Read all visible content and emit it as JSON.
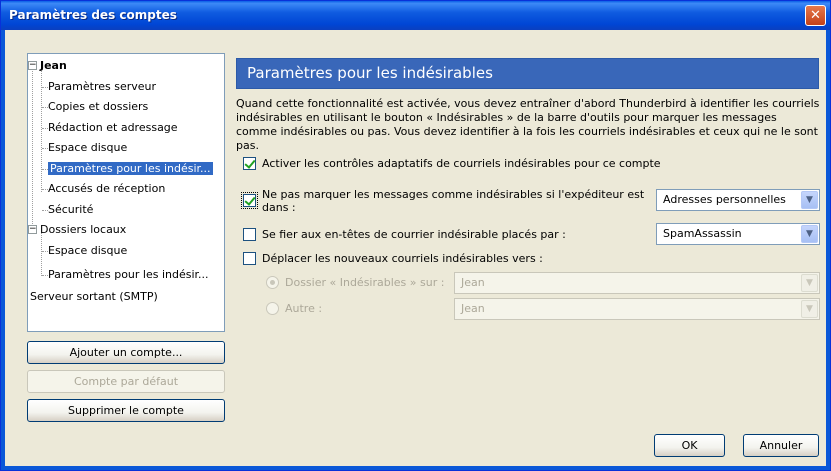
{
  "window": {
    "title": "Paramètres des comptes"
  },
  "tree": {
    "items": [
      {
        "label": "Jean",
        "level": 0,
        "bold": true
      },
      {
        "label": "Paramètres serveur",
        "level": 1
      },
      {
        "label": "Copies et dossiers",
        "level": 1
      },
      {
        "label": "Rédaction et adressage",
        "level": 1
      },
      {
        "label": "Espace disque",
        "level": 1
      },
      {
        "label": "Paramètres pour les indésir...",
        "level": 1,
        "selected": true
      },
      {
        "label": "Accusés de réception",
        "level": 1
      },
      {
        "label": "Sécurité",
        "level": 1
      },
      {
        "label": "Dossiers locaux",
        "level": 0
      },
      {
        "label": "Espace disque",
        "level": 1
      },
      {
        "label": "Paramètres pour les indésir...",
        "level": 1
      },
      {
        "label": "Serveur sortant (SMTP)",
        "level": 0
      }
    ]
  },
  "left_buttons": {
    "add": "Ajouter un compte...",
    "default": "Compte par défaut",
    "delete": "Supprimer le compte"
  },
  "panel": {
    "title": "Paramètres pour les indésirables",
    "description": "Quand cette fonctionnalité est activée, vous devez entraîner d'abord Thunderbird à identifier les courriels indésirables en utilisant le bouton « Indésirables » de la barre d'outils pour marquer les messages comme indésirables ou pas. Vous devez identifier à la fois les courriels indésirables et ceux qui ne le sont pas."
  },
  "options": {
    "adaptive": {
      "label": "Activer les contrôles adaptatifs de courriels indésirables pour ce compte",
      "checked": true
    },
    "whitelist": {
      "label_line1": "Ne pas marquer les messages comme indésirables si l'expéditeur est",
      "label_line2": "dans :",
      "checked": true,
      "select_value": "Adresses personnelles"
    },
    "trust_headers": {
      "label": "Se fier aux en-têtes de courrier indésirable placés par :",
      "checked": false,
      "select_value": "SpamAssassin"
    },
    "move": {
      "label": "Déplacer les nouveaux courriels indésirables vers :",
      "checked": false
    },
    "folder_radio": {
      "label": "Dossier « Indésirables » sur :",
      "selected": true,
      "select_value": "Jean"
    },
    "other_radio": {
      "label": "Autre :",
      "selected": false,
      "select_value": "Jean"
    }
  },
  "dialog_buttons": {
    "ok": "OK",
    "cancel": "Annuler"
  }
}
